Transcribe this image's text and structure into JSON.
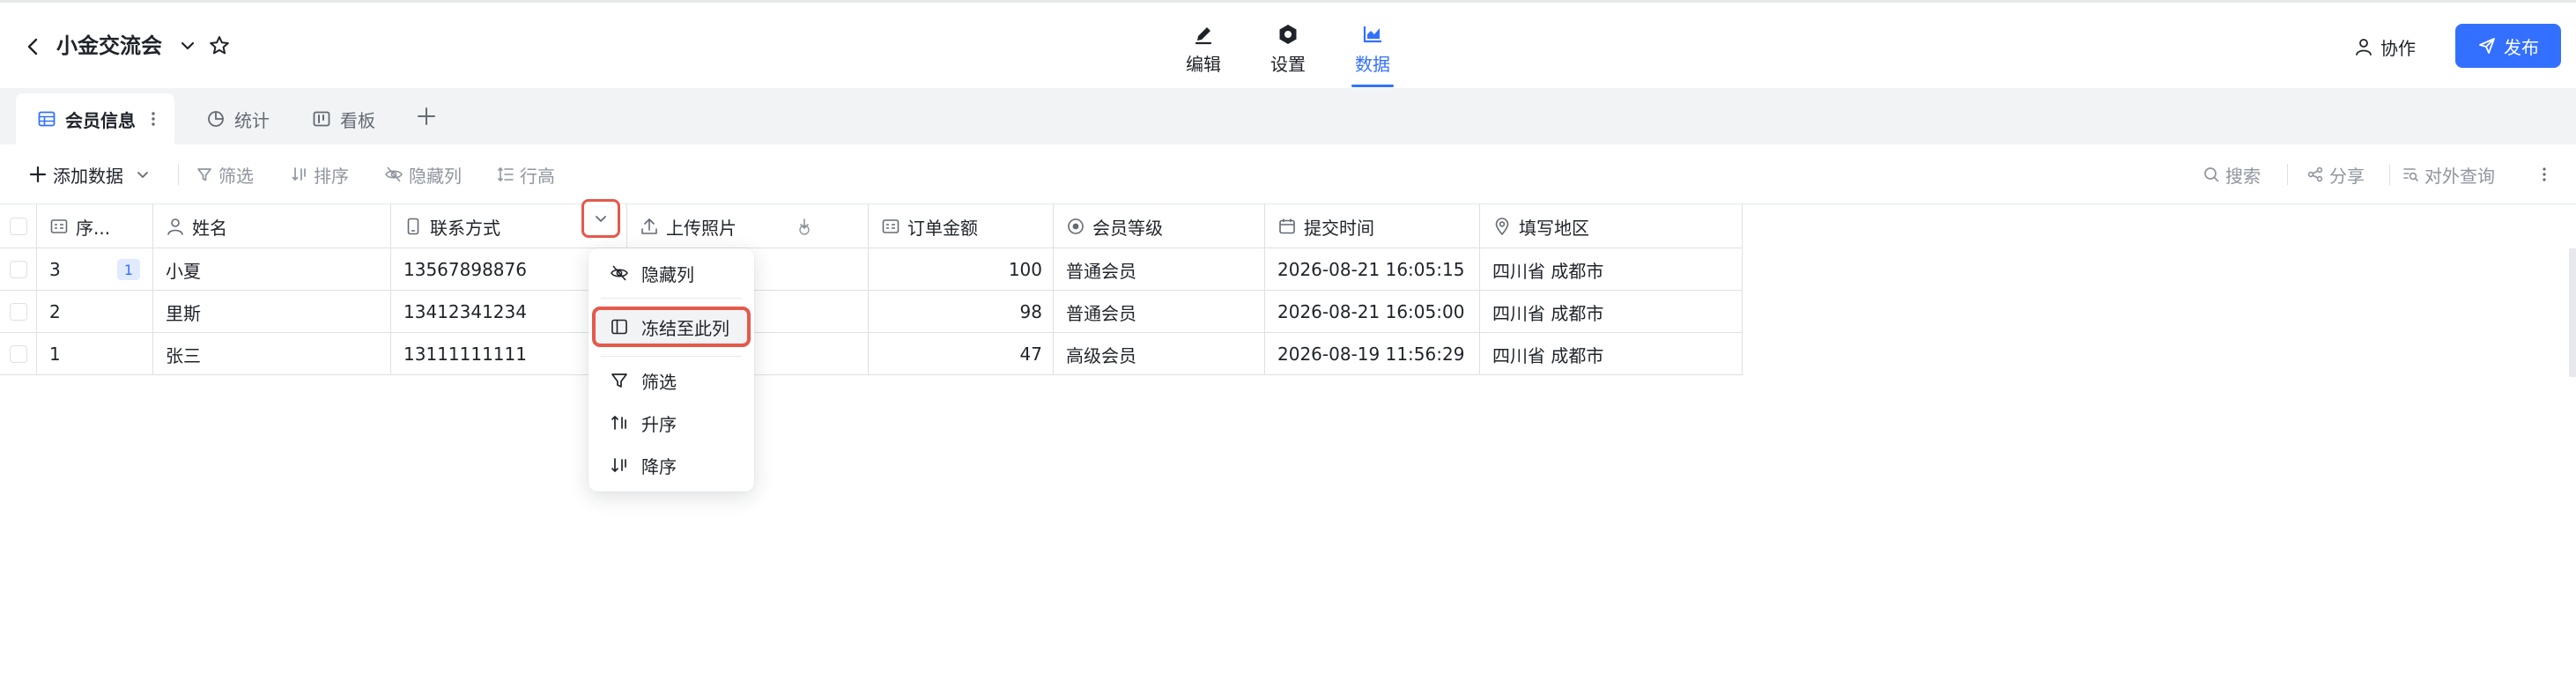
{
  "header": {
    "title": "小金交流会",
    "tabs": [
      {
        "label": "编辑",
        "icon": "edit-icon"
      },
      {
        "label": "设置",
        "icon": "settings-icon"
      },
      {
        "label": "数据",
        "icon": "chart-icon",
        "active": true
      }
    ],
    "collab_label": "协作",
    "publish_label": "发布"
  },
  "sheet_tabs": [
    {
      "label": "会员信息",
      "icon": "table-icon",
      "active": true
    },
    {
      "label": "统计",
      "icon": "pie-chart-icon"
    },
    {
      "label": "看板",
      "icon": "kanban-icon"
    }
  ],
  "toolbar": {
    "add_data": "添加数据",
    "filter": "筛选",
    "sort": "排序",
    "hide_cols": "隐藏列",
    "row_height": "行高",
    "search": "搜索",
    "share": "分享",
    "external_query": "对外查询"
  },
  "table": {
    "columns": [
      {
        "label": "序...",
        "icon": "id-card-icon"
      },
      {
        "label": "姓名",
        "icon": "person-icon"
      },
      {
        "label": "联系方式",
        "icon": "phone-icon"
      },
      {
        "label": "上传照片",
        "icon": "upload-icon"
      },
      {
        "label": "订单金额",
        "icon": "number-field-icon"
      },
      {
        "label": "会员等级",
        "icon": "radio-icon"
      },
      {
        "label": "提交时间",
        "icon": "calendar-icon"
      },
      {
        "label": "填写地区",
        "icon": "location-icon"
      }
    ],
    "rows": [
      {
        "seq": "3",
        "badge": "1",
        "name": "小夏",
        "phone": "13567898876",
        "amount": "100",
        "level": "普通会员",
        "time": "2026-08-21 16:05:15",
        "region": "四川省 成都市"
      },
      {
        "seq": "2",
        "name": "里斯",
        "phone": "13412341234",
        "amount": "98",
        "level": "普通会员",
        "time": "2026-08-21 16:05:00",
        "region": "四川省 成都市"
      },
      {
        "seq": "1",
        "name": "张三",
        "phone": "13111111111",
        "amount": "47",
        "level": "高级会员",
        "time": "2026-08-19 11:56:29",
        "region": "四川省 成都市"
      }
    ]
  },
  "context_menu": {
    "items": [
      {
        "label": "隐藏列",
        "icon": "eye-off-icon"
      },
      {
        "label": "冻结至此列",
        "icon": "freeze-column-icon",
        "highlighted": true
      },
      {
        "label": "筛选",
        "icon": "filter-icon"
      },
      {
        "label": "升序",
        "icon": "sort-ascending-icon"
      },
      {
        "label": "降序",
        "icon": "sort-descending-icon"
      }
    ]
  },
  "colors": {
    "accent": "#3370ff",
    "highlight_outline": "#e5594b",
    "tab_bar_bg": "#f2f3f5"
  }
}
